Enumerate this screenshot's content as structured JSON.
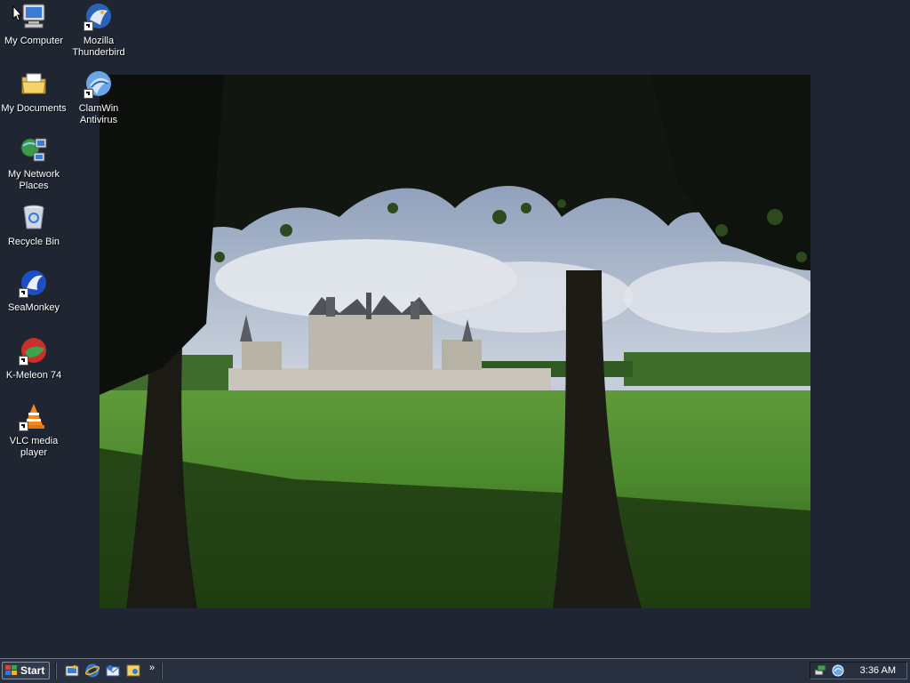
{
  "desktop": {
    "icons": [
      {
        "label": "My Computer",
        "icon": "computer-icon"
      },
      {
        "label": "My Documents",
        "icon": "folder-documents-icon"
      },
      {
        "label": "My Network Places",
        "icon": "network-icon"
      },
      {
        "label": "Recycle Bin",
        "icon": "recycle-bin-icon"
      },
      {
        "label": "SeaMonkey",
        "icon": "seamonkey-icon"
      },
      {
        "label": "K-Meleon 74",
        "icon": "kmeleon-icon"
      },
      {
        "label": "VLC media player",
        "icon": "vlc-cone-icon"
      },
      {
        "label": "Mozilla Thunderbird",
        "icon": "thunderbird-icon"
      },
      {
        "label": "ClamWin Antivirus",
        "icon": "clamwin-icon"
      }
    ]
  },
  "taskbar": {
    "start_label": "Start",
    "quick_launch": [
      "show-desktop-icon",
      "internet-explorer-icon",
      "outlook-express-icon",
      "media-icon"
    ],
    "overflow_label": "»",
    "tray_icons": [
      "network-tray-icon",
      "antivirus-tray-icon"
    ],
    "clock": "3:36 AM"
  },
  "colors": {
    "desktop_bg": "#1f2632",
    "taskbar_bg": "#283040"
  }
}
